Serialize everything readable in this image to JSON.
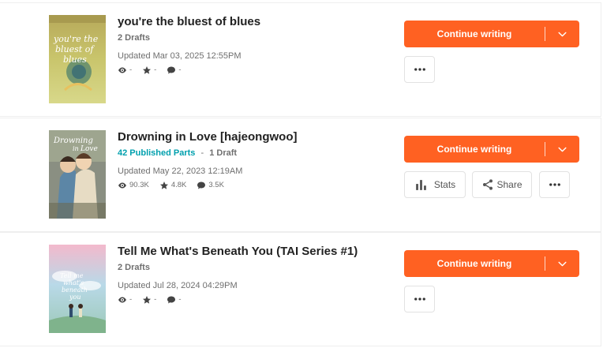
{
  "stories": [
    {
      "title": "you're the bluest of blues",
      "published_parts": "",
      "separator": "",
      "drafts": "2 Drafts",
      "updated": "Updated Mar 03, 2025 12:55PM",
      "reads": "-",
      "votes": "-",
      "comments": "-",
      "continue_label": "Continue writing",
      "stats_label": "",
      "share_label": "",
      "cover_icon": "cover-yellow-green",
      "cover_text": [
        "you're the",
        "bluest of",
        "blues"
      ]
    },
    {
      "title": "Drowning in Love [hajeongwoo]",
      "published_parts": "42 Published Parts",
      "separator": "-",
      "drafts": "1 Draft",
      "updated": "Updated May 22, 2023 12:19AM",
      "reads": "90.3K",
      "votes": "4.8K",
      "comments": "3.5K",
      "continue_label": "Continue writing",
      "stats_label": "Stats",
      "share_label": "Share",
      "cover_icon": "cover-illustrated-couple",
      "cover_text": [
        "Drowning",
        "in",
        "Love"
      ]
    },
    {
      "title": "Tell Me What's Beneath You (TAI Series #1)",
      "published_parts": "",
      "separator": "",
      "drafts": "2 Drafts",
      "updated": "Updated Jul 28, 2024 04:29PM",
      "reads": "-",
      "votes": "-",
      "comments": "-",
      "continue_label": "Continue writing",
      "stats_label": "",
      "share_label": "",
      "cover_icon": "cover-pastel-sky",
      "cover_text": [
        "Tell me",
        "what's",
        "beneath",
        "you"
      ]
    }
  ],
  "colors": {
    "accent": "#ff6122",
    "published": "#00a0ae",
    "muted": "#6f6f6f"
  },
  "icons": [
    "eye-icon",
    "star-icon",
    "comment-icon",
    "chevron-down-icon",
    "more-icon",
    "bar-chart-icon",
    "share-icon"
  ]
}
